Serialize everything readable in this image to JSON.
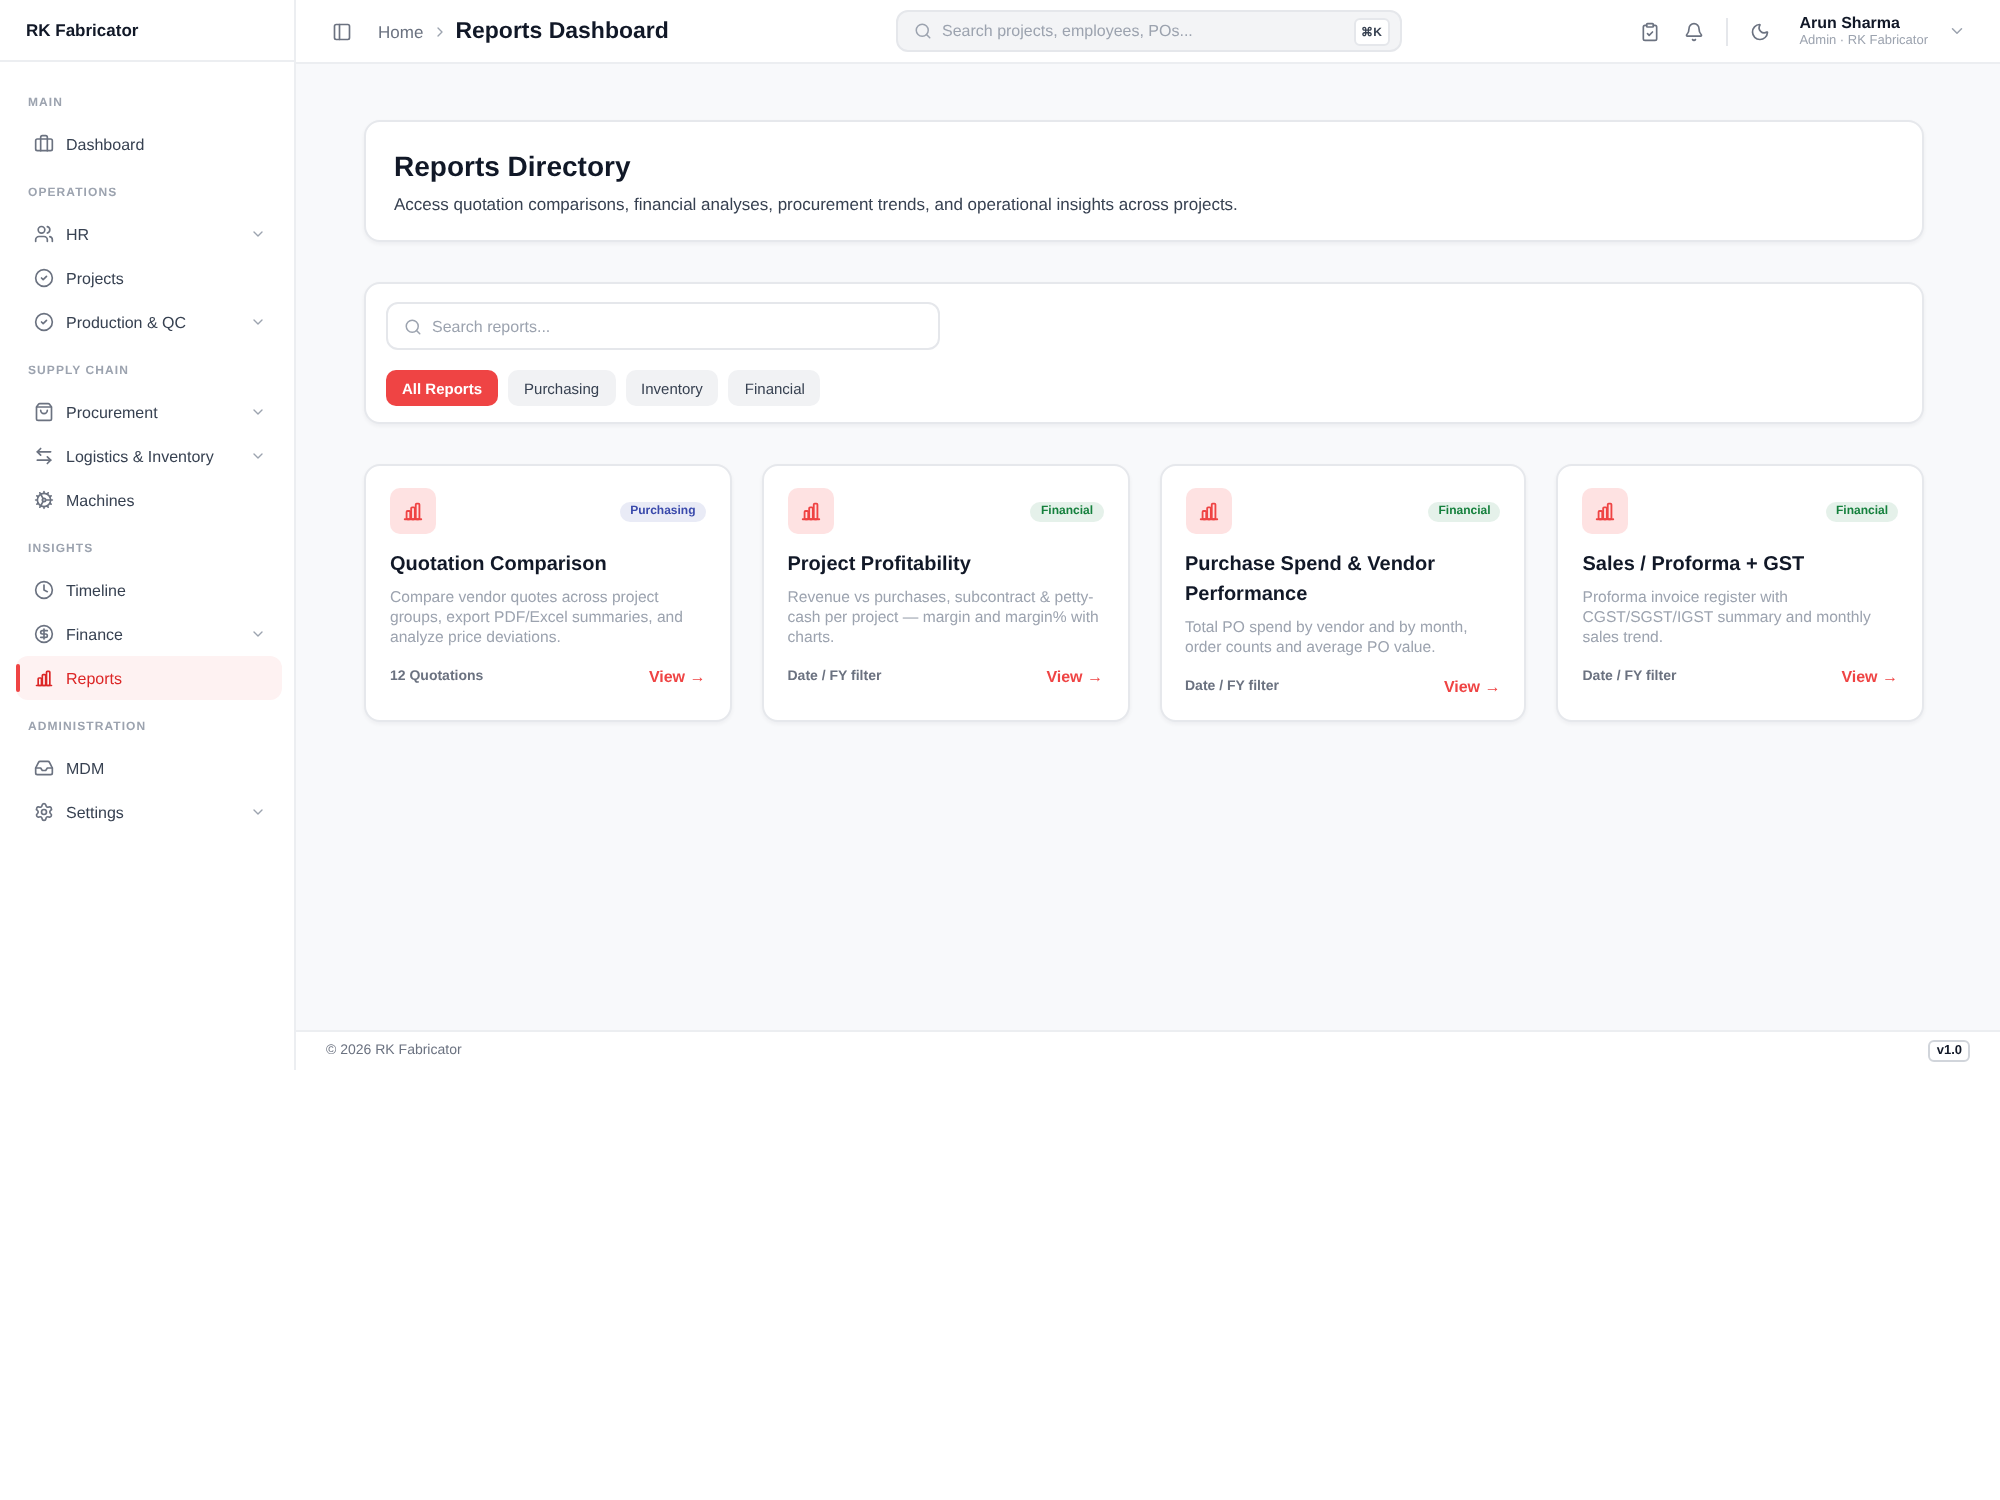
{
  "sidebar": {
    "brand": "RK Fabricator",
    "sections": [
      {
        "title": "MAIN",
        "items": [
          {
            "label": "Dashboard",
            "expandable": false,
            "selected": false
          }
        ]
      },
      {
        "title": "OPERATIONS",
        "items": [
          {
            "label": "HR",
            "expandable": true,
            "selected": false
          },
          {
            "label": "Projects",
            "expandable": false,
            "selected": false
          },
          {
            "label": "Production & QC",
            "expandable": true,
            "selected": false
          }
        ]
      },
      {
        "title": "SUPPLY CHAIN",
        "items": [
          {
            "label": "Procurement",
            "expandable": true,
            "selected": false
          },
          {
            "label": "Logistics & Inventory",
            "expandable": true,
            "selected": false
          },
          {
            "label": "Machines",
            "expandable": false,
            "selected": false
          }
        ]
      },
      {
        "title": "INSIGHTS",
        "items": [
          {
            "label": "Timeline",
            "expandable": false,
            "selected": false
          },
          {
            "label": "Finance",
            "expandable": true,
            "selected": false
          },
          {
            "label": "Reports",
            "expandable": false,
            "selected": true
          }
        ]
      },
      {
        "title": "ADMINISTRATION",
        "items": [
          {
            "label": "MDM",
            "expandable": false,
            "selected": false
          },
          {
            "label": "Settings",
            "expandable": true,
            "selected": false
          }
        ]
      }
    ]
  },
  "topbar": {
    "breadcrumb": [
      {
        "label": "Home",
        "current": false
      },
      {
        "label": "Reports Dashboard",
        "current": true
      }
    ],
    "search": {
      "placeholder": "Search projects, employees, POs...",
      "shortcut": "⌘K"
    },
    "user": {
      "name": "Arun Sharma",
      "role": "Admin · RK Fabricator"
    }
  },
  "directory": {
    "title": "Reports Directory",
    "description": "Access quotation comparisons, financial analyses, procurement trends, and operational insights across projects."
  },
  "filters": {
    "search": {
      "placeholder": "Search reports..."
    },
    "tabs": [
      {
        "label": "All Reports",
        "selected": true
      },
      {
        "label": "Purchasing",
        "selected": false
      },
      {
        "label": "Inventory",
        "selected": false
      },
      {
        "label": "Financial",
        "selected": false
      }
    ]
  },
  "reports": [
    {
      "title": "Quotation Comparison",
      "tag": {
        "label": "Purchasing",
        "color": "#3949ab"
      },
      "description": "Compare vendor quotes across project groups, export PDF/Excel summaries, and analyze price deviations.",
      "meta": "12 Quotations",
      "link": "View →"
    },
    {
      "title": "Project Profitability",
      "tag": {
        "label": "Financial",
        "color": "#15803d"
      },
      "description": "Revenue vs purchases, subcontract & petty-cash per project — margin and margin% with charts.",
      "meta": "Date / FY filter",
      "link": "View →"
    },
    {
      "title": "Purchase Spend & Vendor Performance",
      "tag": {
        "label": "Financial",
        "color": "#15803d"
      },
      "description": "Total PO spend by vendor and by month, order counts and average PO value.",
      "meta": "Date / FY filter",
      "link": "View →"
    },
    {
      "title": "Sales / Proforma + GST",
      "tag": {
        "label": "Financial",
        "color": "#15803d"
      },
      "description": "Proforma invoice register with CGST/SGST/IGST summary and monthly sales trend.",
      "meta": "Date / FY filter",
      "link": "View →"
    }
  ],
  "footer": {
    "copyright": "© 2026 RK Fabricator",
    "version": "v1.0"
  }
}
